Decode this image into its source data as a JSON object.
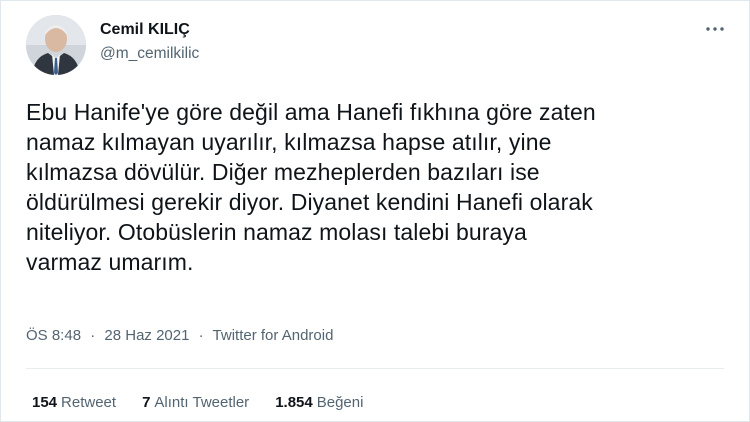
{
  "author": {
    "display_name": "Cemil KILIÇ",
    "handle": "@m_cemilkilic"
  },
  "tweet": {
    "lines": [
      "Ebu Hanife'ye göre değil ama Hanefi fıkhına göre zaten",
      "namaz kılmayan uyarılır, kılmazsa hapse atılır, yine",
      "kılmazsa dövülür. Diğer mezheplerden bazıları ise",
      "öldürülmesi gerekir diyor. Diyanet kendini Hanefi olarak",
      "niteliyor. Otobüslerin namaz molası talebi buraya",
      "varmaz umarım."
    ]
  },
  "meta": {
    "time": "ÖS 8:48",
    "separator": "·",
    "date": "28 Haz 2021",
    "source": "Twitter for Android"
  },
  "stats": {
    "retweets": {
      "count": "154",
      "label": "Retweet"
    },
    "quotes": {
      "count": "7",
      "label": "Alıntı Tweetler"
    },
    "likes": {
      "count": "1.854",
      "label": "Beğeni"
    }
  },
  "icons": {
    "more": "more-horizontal-icon",
    "avatar": "profile-photo"
  },
  "colors": {
    "text_primary": "#0f1419",
    "text_secondary": "#536471",
    "border": "#e1e8ed"
  }
}
